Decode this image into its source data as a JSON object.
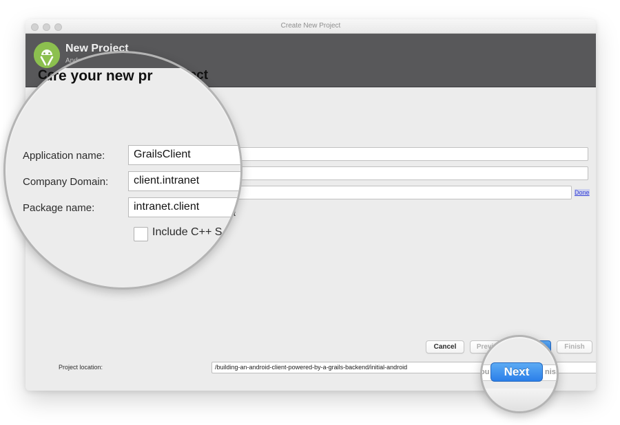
{
  "window": {
    "title": "Create New Project",
    "traffic_lights": [
      "close",
      "minimize",
      "zoom"
    ]
  },
  "header": {
    "title": "New Project",
    "subtitle": "Android Studio",
    "logo_icon": "android-studio-logo-icon",
    "step_title": "Configure your new project",
    "step_title_visible_fragment": "ure your new pr"
  },
  "form": {
    "fields": [
      {
        "label": "Application name:",
        "value": "GrailsClient"
      },
      {
        "label": "Company Domain:",
        "value": "client.intranet"
      },
      {
        "label": "Package name:",
        "value": "intranet.client"
      }
    ],
    "edit_link": "Done",
    "checkbox": {
      "label": "Include C++ Support",
      "visible_fragment": "Include C++ S",
      "checked": false
    },
    "project_location": {
      "label": "Project location:",
      "label_visible_fragment": "Project loca",
      "value": "/building-an-android-client-powered-by-a-grails-backend/initial-android",
      "browse_label": "..."
    }
  },
  "footer": {
    "buttons": [
      {
        "label": "Cancel",
        "state": "enabled",
        "primary": false
      },
      {
        "label": "Previous",
        "state": "disabled",
        "primary": false
      },
      {
        "label": "Next",
        "state": "enabled",
        "primary": true
      },
      {
        "label": "Finish",
        "state": "disabled",
        "primary": false
      }
    ]
  },
  "magnifiers": [
    {
      "name": "form-magnifier",
      "target": "application-name-company-domain-package-name-fields",
      "labels": [
        "Application name:",
        "Company Domain:",
        "Package name:"
      ],
      "values": [
        "GrailsClient",
        "client.intranet",
        "intranet.client"
      ],
      "checkbox_label": "Include C++ S",
      "title_fragment": "ure your new pr"
    },
    {
      "name": "next-button-magnifier",
      "target": "next-button",
      "button_label": "Next",
      "left_fragment": "iou",
      "right_fragment": "nish"
    }
  ],
  "colors": {
    "header_band": "#58585a",
    "dialog_bg": "#ececec",
    "primary_button": "#2a7ee8",
    "link": "#3b46d6",
    "logo_green": "#8cc04f"
  }
}
